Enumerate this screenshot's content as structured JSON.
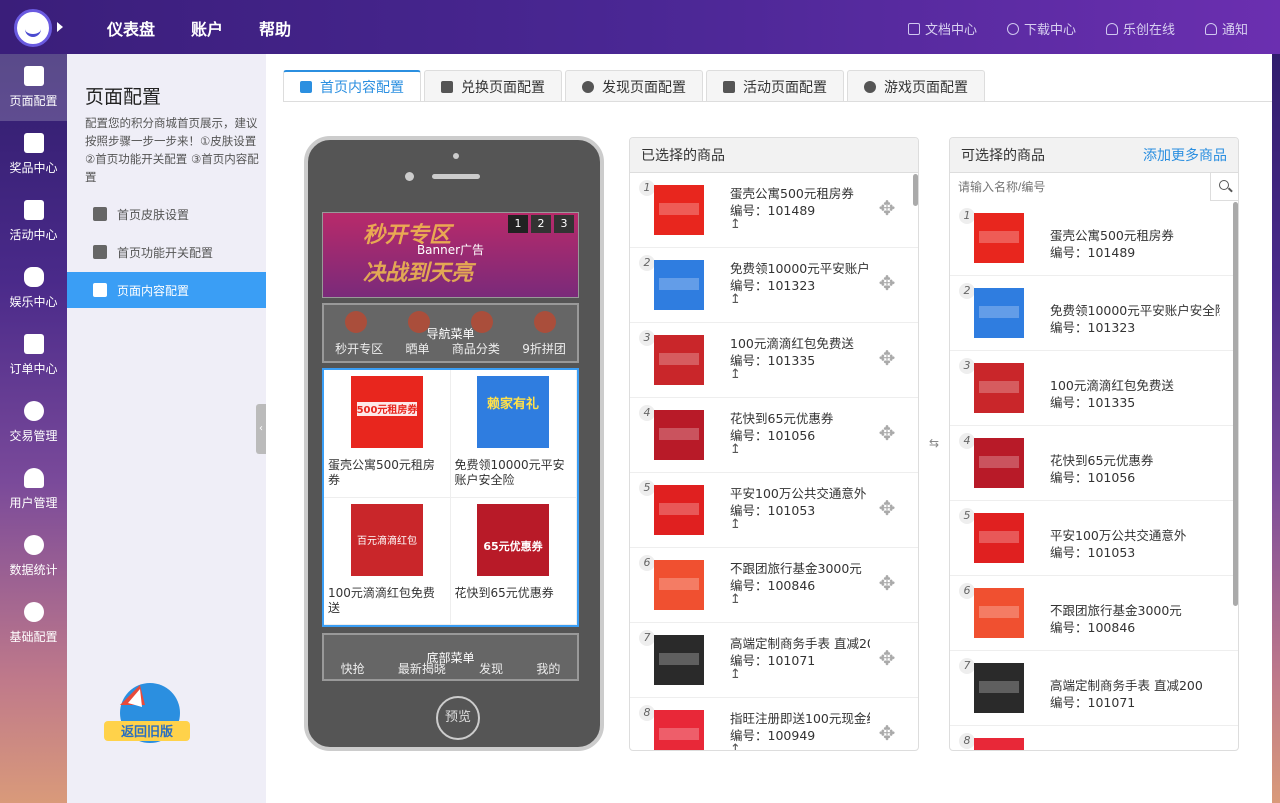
{
  "topnav": {
    "items": [
      "仪表盘",
      "账户",
      "帮助"
    ]
  },
  "topright": {
    "items": [
      {
        "label": "文档中心",
        "icon": "document-icon"
      },
      {
        "label": "下载中心",
        "icon": "cloud-download-icon"
      },
      {
        "label": "乐创在线",
        "icon": "user-icon"
      },
      {
        "label": "通知",
        "icon": "bell-icon"
      }
    ]
  },
  "leftnav": {
    "items": [
      {
        "label": "页面配置",
        "icon": "page-config-icon"
      },
      {
        "label": "奖品中心",
        "icon": "gift-icon"
      },
      {
        "label": "活动中心",
        "icon": "flag-icon"
      },
      {
        "label": "娱乐中心",
        "icon": "gamepad-icon"
      },
      {
        "label": "订单中心",
        "icon": "clipboard-icon"
      },
      {
        "label": "交易管理",
        "icon": "yen-icon"
      },
      {
        "label": "用户管理",
        "icon": "user-icon"
      },
      {
        "label": "数据统计",
        "icon": "pie-chart-icon"
      },
      {
        "label": "基础配置",
        "icon": "gear-icon"
      }
    ]
  },
  "subnav": {
    "title": "页面配置",
    "desc": "配置您的积分商城首页展示，建议按照步骤一步一步来！①皮肤设置 ②首页功能开关配置 ③首页内容配置",
    "items": [
      "首页皮肤设置",
      "首页功能开关配置",
      "页面内容配置"
    ],
    "old_version": "返回旧版"
  },
  "tabs": [
    "首页内容配置",
    "兑换页面配置",
    "发现页面配置",
    "活动页面配置",
    "游戏页面配置"
  ],
  "phone": {
    "banner_text1": "秒开专区",
    "banner_text2": "决战到天亮",
    "banner_label": "Banner广告",
    "banner_dots": [
      "1",
      "2",
      "3"
    ],
    "nav_label": "导航菜单",
    "nav_items": [
      "秒开专区",
      "晒单",
      "商品分类",
      "9折拼团"
    ],
    "products": [
      {
        "name": "蛋壳公寓500元租房券",
        "color": "#e8261e",
        "tag": "500元租房券"
      },
      {
        "name": "免费领10000元平安账户安全险",
        "color": "#2f7de0",
        "tag": "赖家有礼"
      },
      {
        "name": "100元滴滴红包免费送",
        "color": "#c9262a",
        "tag": "百元滴滴红包"
      },
      {
        "name": "花快到65元优惠券",
        "color": "#b81a28",
        "tag": "65元优惠券"
      }
    ],
    "footer_label": "底部菜单",
    "footer_items": [
      "快抢",
      "最新揭晓",
      "发现",
      "我的"
    ],
    "preview": "预览"
  },
  "selected": {
    "title": "已选择的商品",
    "code_prefix": "编号：",
    "items": [
      {
        "n": "1",
        "name": "蛋壳公寓500元租房券",
        "code": "101489",
        "color": "#e8261e"
      },
      {
        "n": "2",
        "name": "免费领10000元平安账户",
        "code": "101323",
        "color": "#2f7de0"
      },
      {
        "n": "3",
        "name": "100元滴滴红包免费送",
        "code": "101335",
        "color": "#c9262a"
      },
      {
        "n": "4",
        "name": "花快到65元优惠券",
        "code": "101056",
        "color": "#b81a28"
      },
      {
        "n": "5",
        "name": "平安100万公共交通意外",
        "code": "101053",
        "color": "#e02020"
      },
      {
        "n": "6",
        "name": "不跟团旅行基金3000元",
        "code": "100846",
        "color": "#f05030"
      },
      {
        "n": "7",
        "name": "高端定制商务手表 直减20",
        "code": "101071",
        "color": "#2a2a2a"
      },
      {
        "n": "8",
        "name": "指旺注册即送100元现金红",
        "code": "100949",
        "color": "#e82838"
      }
    ]
  },
  "available": {
    "title": "可选择的商品",
    "add_more": "添加更多商品",
    "search_placeholder": "请输入名称/编号",
    "code_prefix": "编号：",
    "items": [
      {
        "n": "1",
        "name": "蛋壳公寓500元租房券",
        "code": "101489",
        "color": "#e8261e"
      },
      {
        "n": "2",
        "name": "免费领10000元平安账户安全险",
        "code": "101323",
        "color": "#2f7de0"
      },
      {
        "n": "3",
        "name": "100元滴滴红包免费送",
        "code": "101335",
        "color": "#c9262a"
      },
      {
        "n": "4",
        "name": "花快到65元优惠券",
        "code": "101056",
        "color": "#b81a28"
      },
      {
        "n": "5",
        "name": "平安100万公共交通意外",
        "code": "101053",
        "color": "#e02020"
      },
      {
        "n": "6",
        "name": "不跟团旅行基金3000元",
        "code": "100846",
        "color": "#f05030"
      },
      {
        "n": "7",
        "name": "高端定制商务手表 直减200",
        "code": "101071",
        "color": "#2a2a2a"
      },
      {
        "n": "8",
        "name": "",
        "code": "",
        "color": "#e82838"
      }
    ]
  },
  "colors": {
    "accent": "#3a9ef5",
    "link": "#2b8fe0",
    "topbar": "#4a2794"
  }
}
